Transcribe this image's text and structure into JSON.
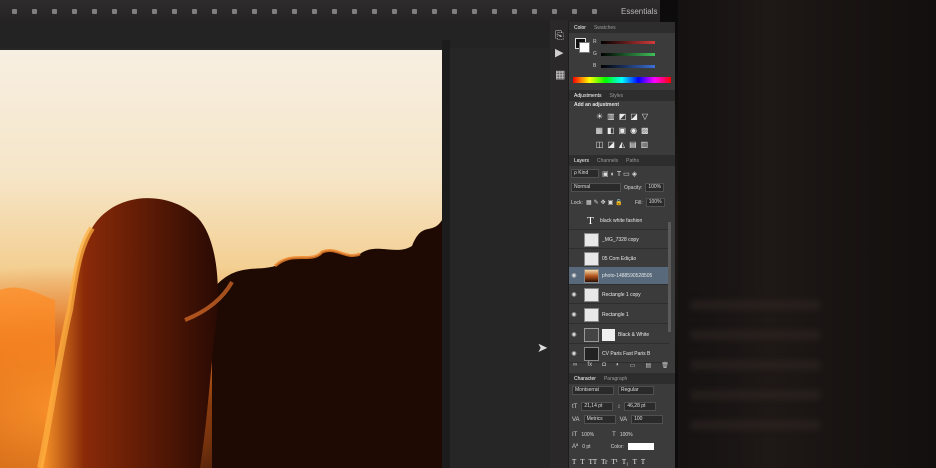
{
  "app": {
    "workspace_label": "Essentials"
  },
  "left_tools": {
    "icons": [
      "play-triangle-icon",
      "arrange-icon"
    ],
    "glyphs": [
      "▶",
      "▦"
    ]
  },
  "panels": {
    "color": {
      "tabs": [
        "Color",
        "Swatches"
      ],
      "channels": [
        {
          "label": "R",
          "color": "#d43a3a"
        },
        {
          "label": "G",
          "color": "#3fbf5a"
        },
        {
          "label": "B",
          "color": "#3b6fd6"
        }
      ]
    },
    "adjustments": {
      "tabs": [
        "Adjustments",
        "Styles"
      ],
      "title": "Add an adjustment",
      "rows": [
        [
          "☀",
          "▥",
          "◩",
          "◪",
          "▽"
        ],
        [
          "▦",
          "◧",
          "▣",
          "◉",
          "▩"
        ],
        [
          "◫",
          "◪",
          "◭",
          "▤",
          "▥"
        ]
      ]
    },
    "layers": {
      "tabs": [
        "Layers",
        "Channels",
        "Paths"
      ],
      "filter_label": "ρ Kind",
      "blend_mode": "Normal",
      "opacity_label": "Opacity:",
      "opacity_value": "100%",
      "lock_label": "Lock:",
      "fill_label": "Fill:",
      "fill_value": "100%",
      "items": [
        {
          "name": "black white fashion",
          "visible": false,
          "thumb": "text",
          "selected": false
        },
        {
          "name": "_MG_7328 copy",
          "visible": false,
          "thumb": "plain",
          "selected": false
        },
        {
          "name": "05 Com Edição",
          "visible": false,
          "thumb": "plain",
          "selected": false
        },
        {
          "name": "photo-1488590528505",
          "visible": true,
          "thumb": "photo",
          "selected": true
        },
        {
          "name": "Rectangle 1 copy",
          "visible": true,
          "thumb": "plain",
          "selected": false
        },
        {
          "name": "Rectangle 1",
          "visible": true,
          "thumb": "plain",
          "selected": false
        },
        {
          "name": "Black & White",
          "visible": true,
          "thumb": "mask",
          "selected": false
        },
        {
          "name": "CV Paris Fast Paris B",
          "visible": true,
          "thumb": "plain",
          "selected": false
        }
      ],
      "footer_icons": [
        "∞",
        "fx",
        "◘",
        "◐",
        "▭",
        "▤",
        "🗑"
      ]
    },
    "character": {
      "tabs": [
        "Character",
        "Paragraph"
      ],
      "font_family": "Montserrat Hair...",
      "font_style": "Regular",
      "font_size": "21,14 pt",
      "leading": "46,28 pt",
      "kerning": "Metrics",
      "tracking": "100",
      "vscale": "100%",
      "hscale": "100%",
      "baseline": "0 pt",
      "color_label": "Color:",
      "style_buttons": [
        "T",
        "T",
        "TT",
        "Tr",
        "T¹",
        "T₁",
        "T",
        "T"
      ]
    }
  }
}
